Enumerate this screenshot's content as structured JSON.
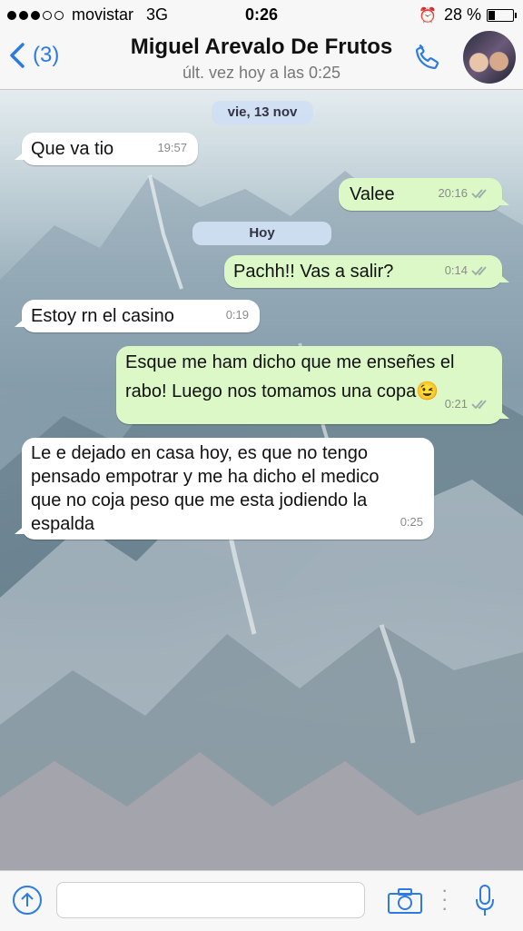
{
  "status_bar": {
    "carrier": "movistar",
    "network": "3G",
    "time": "0:26",
    "battery_percent": "28 %",
    "battery_level": 0.28,
    "signal_dots_filled": 3,
    "signal_dots_total": 5
  },
  "header": {
    "back_label": "(3)",
    "contact_name": "Miguel Arevalo De Frutos",
    "last_seen": "últ. vez hoy a las 0:25",
    "icons": [
      "chevron-left-icon",
      "phone-icon",
      "avatar"
    ]
  },
  "colors": {
    "accent": "#2c7be5",
    "incoming_bubble": "#ffffff",
    "outgoing_bubble": "#dcf8c6",
    "date_pill": "#d0dff2"
  },
  "chat": {
    "date_1": "vie, 13 nov",
    "date_2": "Hoy",
    "messages": [
      {
        "direction": "in",
        "text": "Que va tio",
        "time": "19:57"
      },
      {
        "direction": "out",
        "text": "Valee",
        "time": "20:16",
        "read": true
      },
      {
        "direction": "out",
        "text": "Pachh!! Vas a salir?",
        "time": "0:14",
        "read": true
      },
      {
        "direction": "in",
        "text": "Estoy rn el casino",
        "time": "0:19"
      },
      {
        "direction": "out",
        "line1": "Esque me ham dicho que me enseñes el",
        "line2": "rabo! Luego nos tomamos una copa",
        "emoji": "😉",
        "time": "0:21",
        "read": true
      },
      {
        "direction": "in",
        "line1": "Le e dejado en casa hoy, es que no tengo",
        "line2": "pensado empotrar y me ha dicho el medico",
        "line3": "que no coja peso que me esta jodiendo la",
        "line4": "espalda",
        "time": "0:25"
      }
    ]
  },
  "composer": {
    "input_value": "",
    "icons": [
      "upload-icon",
      "camera-icon",
      "microphone-icon"
    ]
  }
}
